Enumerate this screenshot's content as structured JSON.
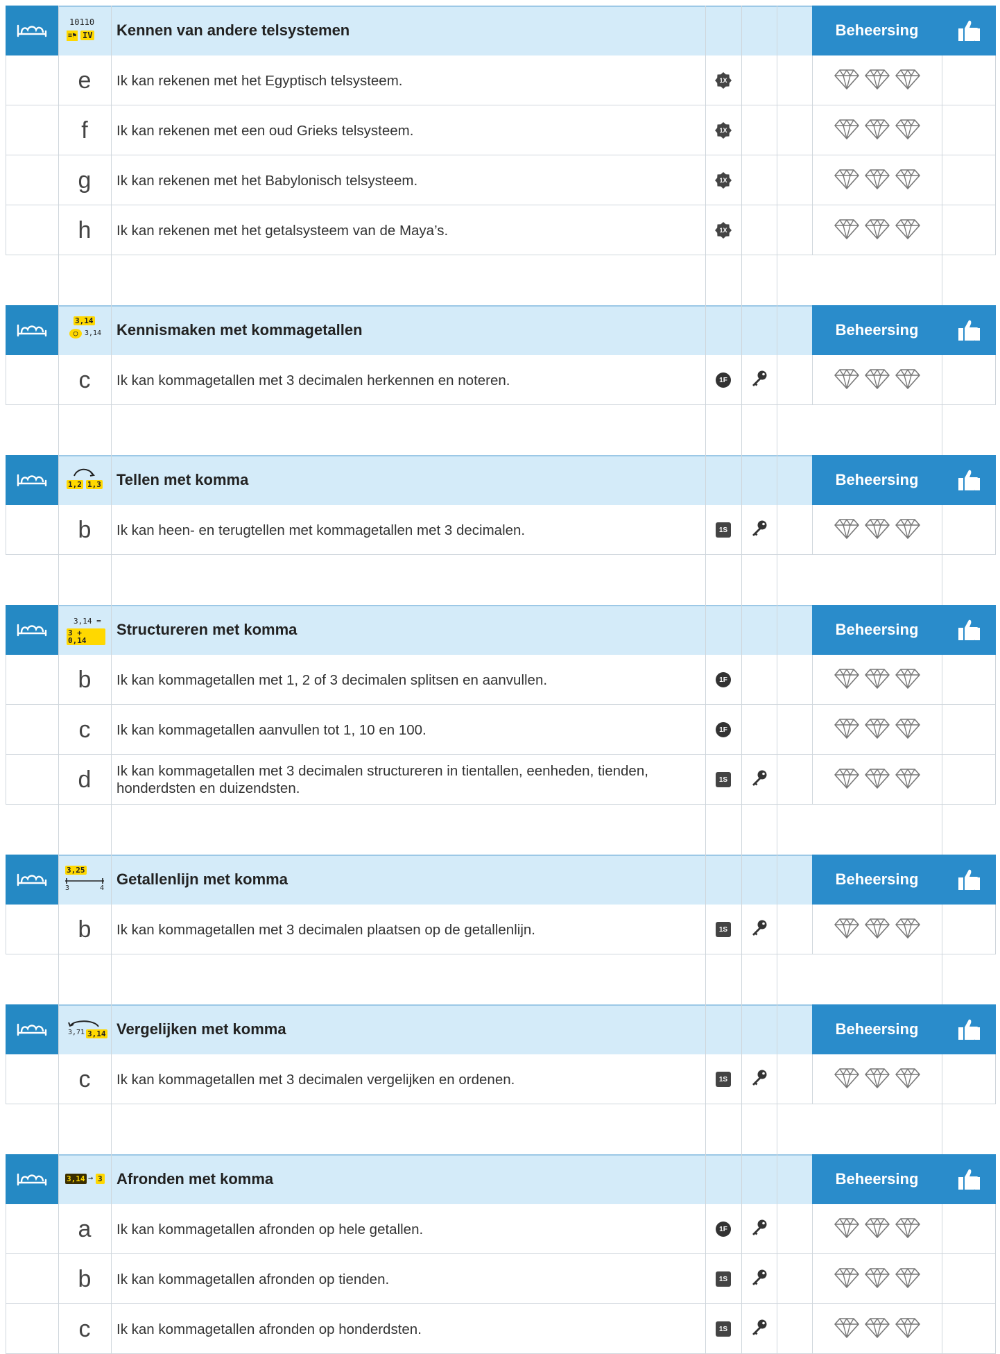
{
  "header_label": "Beheersing",
  "colors": {
    "accent": "#2a8ccb",
    "header_bg": "#d4ebf9",
    "highlight": "#ffd800"
  },
  "sections": [
    {
      "title": "Kennen van andere telsystemen",
      "icon": "telsystemen-icon",
      "icon_text": {
        "top": "10110",
        "bottom": "IV"
      },
      "items": [
        {
          "letter": "e",
          "text": "Ik kan rekenen met het Egyptisch telsysteem.",
          "badge": "1X",
          "badge_shape": "star",
          "key": false
        },
        {
          "letter": "f",
          "text": "Ik kan rekenen met een oud Grieks telsysteem.",
          "badge": "1X",
          "badge_shape": "star",
          "key": false
        },
        {
          "letter": "g",
          "text": "Ik kan rekenen met het Babylonisch telsysteem.",
          "badge": "1X",
          "badge_shape": "star",
          "key": false
        },
        {
          "letter": "h",
          "text": "Ik kan rekenen met het getalsysteem van de Maya’s.",
          "badge": "1X",
          "badge_shape": "star",
          "key": false
        }
      ]
    },
    {
      "title": "Kennismaken met kommagetallen",
      "icon": "kommagetallen-icon",
      "icon_text": {
        "top": "3,14",
        "bottom": "3,14"
      },
      "items": [
        {
          "letter": "c",
          "text": "Ik kan kommagetallen met 3 decimalen herkennen en noteren.",
          "badge": "1F",
          "badge_shape": "circle",
          "key": true
        }
      ]
    },
    {
      "title": "Tellen met komma",
      "icon": "tellen-icon",
      "icon_text": {
        "top": "1,2",
        "bottom": "1,3"
      },
      "items": [
        {
          "letter": "b",
          "text": "Ik kan heen- en terugtellen met kommagetallen met 3 decimalen.",
          "badge": "1S",
          "badge_shape": "square",
          "key": true
        }
      ]
    },
    {
      "title": "Structureren met komma",
      "icon": "structureren-icon",
      "icon_text": {
        "top": "3,14 =",
        "bottom": "3 + 0,14"
      },
      "items": [
        {
          "letter": "b",
          "text": "Ik kan kommagetallen met 1, 2 of 3 decimalen splitsen en aanvullen.",
          "badge": "1F",
          "badge_shape": "circle",
          "key": false
        },
        {
          "letter": "c",
          "text": "Ik kan kommagetallen aanvullen tot 1, 10 en 100.",
          "badge": "1F",
          "badge_shape": "circle",
          "key": false
        },
        {
          "letter": "d",
          "text": "Ik kan kommagetallen met 3 decimalen structureren in tientallen, eenheden, tienden, honderdsten en duizendsten.",
          "badge": "1S",
          "badge_shape": "square",
          "key": true
        }
      ]
    },
    {
      "title": "Getallenlijn met komma",
      "icon": "getallenlijn-icon",
      "icon_text": {
        "top": "3,25",
        "left": "3",
        "right": "4"
      },
      "items": [
        {
          "letter": "b",
          "text": "Ik kan kommagetallen met 3 decimalen plaatsen op de getallenlijn.",
          "badge": "1S",
          "badge_shape": "square",
          "key": true
        }
      ]
    },
    {
      "title": "Vergelijken met komma",
      "icon": "vergelijken-icon",
      "icon_text": {
        "top": "3,71",
        "bottom": "3,14"
      },
      "items": [
        {
          "letter": "c",
          "text": "Ik kan kommagetallen met 3 decimalen vergelijken en ordenen.",
          "badge": "1S",
          "badge_shape": "square",
          "key": true
        }
      ]
    },
    {
      "title": "Afronden met komma",
      "icon": "afronden-icon",
      "icon_text": {
        "top": "3,14",
        "bottom": "3"
      },
      "items": [
        {
          "letter": "a",
          "text": "Ik kan kommagetallen afronden op hele getallen.",
          "badge": "1F",
          "badge_shape": "circle",
          "key": true
        },
        {
          "letter": "b",
          "text": "Ik kan kommagetallen afronden op tienden.",
          "badge": "1S",
          "badge_shape": "square",
          "key": true
        },
        {
          "letter": "c",
          "text": "Ik kan kommagetallen afronden op honderdsten.",
          "badge": "1S",
          "badge_shape": "square",
          "key": true
        }
      ]
    }
  ]
}
